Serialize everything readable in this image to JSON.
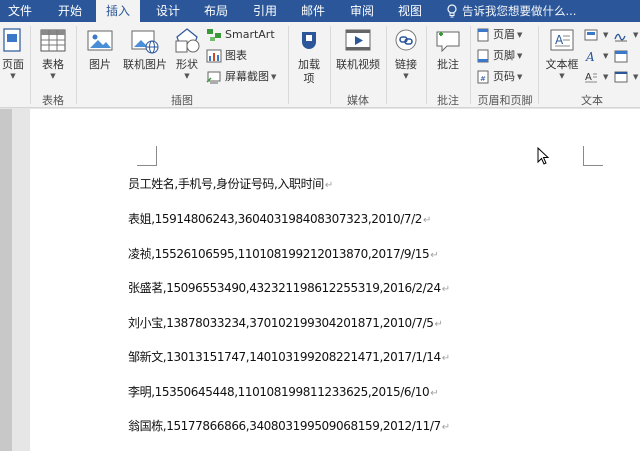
{
  "tabs": [
    {
      "label": "文件"
    },
    {
      "label": "开始"
    },
    {
      "label": "插入",
      "active": true
    },
    {
      "label": "设计"
    },
    {
      "label": "布局"
    },
    {
      "label": "引用"
    },
    {
      "label": "邮件"
    },
    {
      "label": "审阅"
    },
    {
      "label": "视图"
    }
  ],
  "tell_me": "告诉我您想要做什么...",
  "ribbon": {
    "pages": {
      "label": "页面"
    },
    "table": {
      "label": "表格",
      "group": "表格"
    },
    "illustrations": {
      "group": "插图",
      "picture": "图片",
      "online_picture": "联机图片",
      "shapes": "形状",
      "smartart": "SmartArt",
      "chart": "图表",
      "screenshot": "屏幕截图"
    },
    "addins": {
      "label_line1": "加载",
      "label_line2": "项"
    },
    "media": {
      "group": "媒体",
      "online_video": "联机视频"
    },
    "links": {
      "label": "链接"
    },
    "comments": {
      "group": "批注",
      "comment": "批注"
    },
    "header_footer": {
      "group": "页眉和页脚",
      "header": "页眉",
      "footer": "页脚",
      "page_number": "页码"
    },
    "text": {
      "group": "文本",
      "textbox": "文本框"
    }
  },
  "document": {
    "lines": [
      "员工姓名,手机号,身份证号码,入职时间",
      "表姐,15914806243,360403198408307323,2010/7/2",
      "凌祯,15526106595,110108199212013870,2017/9/15",
      "张盛茗,15096553490,432321198612255319,2016/2/24",
      "刘小宝,13878033234,370102199304201871,2010/7/5",
      "邹新文,13013151747,140103199208221471,2017/1/14",
      "李明,15350645448,110108199811233625,2015/6/10",
      "翁国栋,15177866866,340803199509068159,2012/11/7"
    ],
    "paragraph_mark": "↵"
  },
  "colors": {
    "accent": "#2b579a"
  }
}
